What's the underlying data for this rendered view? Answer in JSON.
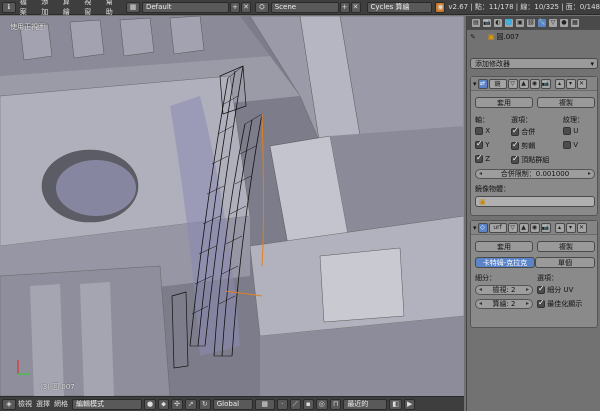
{
  "topbar": {
    "menus": [
      "檔案",
      "添加",
      "算繪",
      "視窗",
      "幫助"
    ],
    "layout": "Default",
    "scene": "Scene",
    "engine": "Cycles 算繪",
    "stats": "v2.67 | 點：11/178 | 線：10/325 | 面：0/148"
  },
  "viewport": {
    "view_label": "使用正視圖",
    "object_label": "(3) 圓.007"
  },
  "bottombar": {
    "view": "檢視",
    "select": "選擇",
    "mesh": "網格",
    "mode": "編輯模式",
    "orientation": "Global",
    "snap": "最近的"
  },
  "panel": {
    "object_name": "圓.007",
    "add_modifier": "添加修改器",
    "mirror": {
      "name": "鏡",
      "apply": "套用",
      "copy": "複製",
      "axis_title": "軸：",
      "options_title": "選項：",
      "texture_title": "紋理：",
      "x": "X",
      "y": "Y",
      "z": "Z",
      "merge": "合併",
      "clipping": "剪輯",
      "vertex_groups": "頂點群組",
      "u": "U",
      "v": "V",
      "merge_limit": "合併限制：0.001000",
      "mirror_object": "鏡像物體："
    },
    "subsurf": {
      "name": "urf",
      "apply": "套用",
      "copy": "複製",
      "catmull": "卡特姆-克拉克",
      "simple": "單個",
      "subdiv_title": "細分：",
      "options_title": "選項：",
      "view": "檢視: 2",
      "render": "算繪: 2",
      "subdiv_uv": "細分 UV",
      "optimal": "最佳化顯示"
    }
  }
}
